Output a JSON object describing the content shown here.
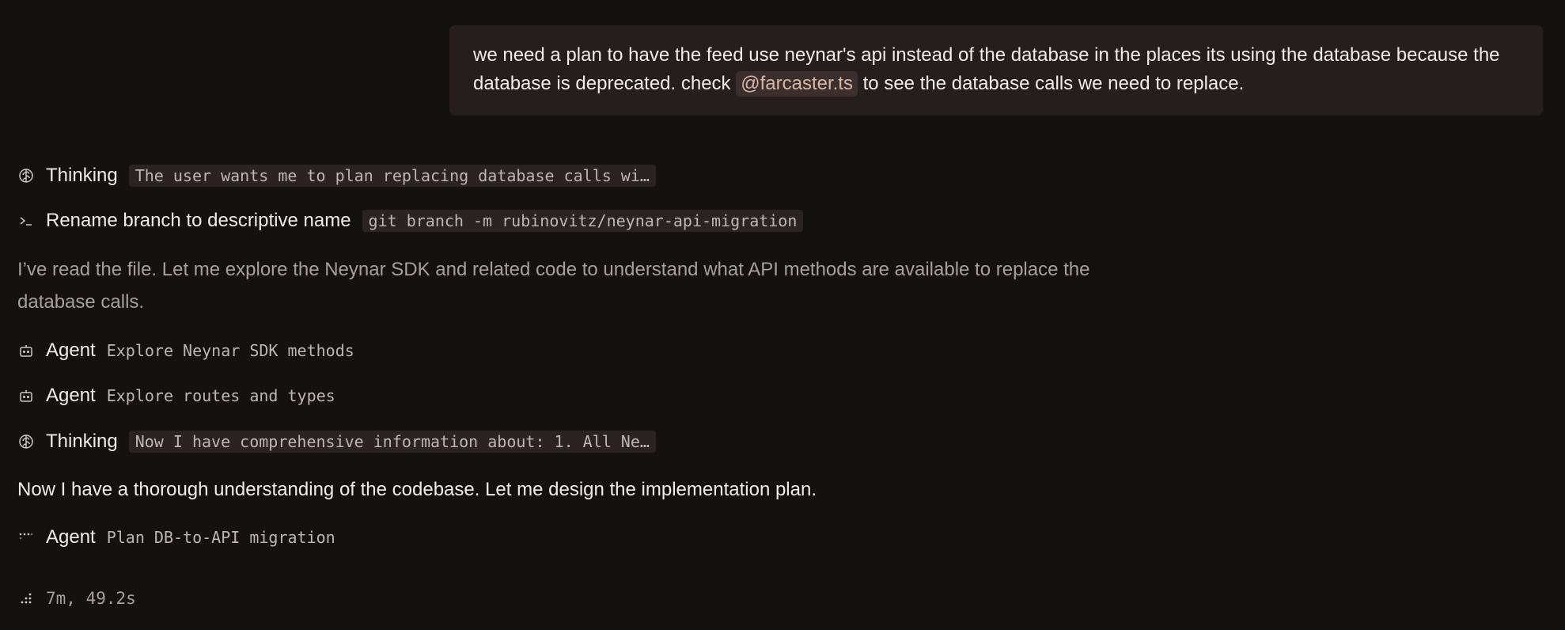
{
  "user_message": {
    "text_before": "we need a plan to have the feed use neynar's api instead of the database in the places its using the database because the database is deprecated. check",
    "mention": "@farcaster.ts",
    "text_after": "to see the database calls we need to replace."
  },
  "steps": [
    {
      "icon": "brain-icon",
      "label": "Thinking",
      "detail": "The user wants me to plan replacing database calls wi…"
    },
    {
      "icon": "terminal-icon",
      "label": "Rename branch to descriptive name",
      "detail": "git branch -m rubinovitz/neynar-api-migration"
    },
    {
      "icon": "robot-icon",
      "label": "Agent",
      "detail": "Explore Neynar SDK methods"
    },
    {
      "icon": "robot-icon",
      "label": "Agent",
      "detail": "Explore routes and types"
    },
    {
      "icon": "brain-icon",
      "label": "Thinking",
      "detail": "Now I have comprehensive information about: 1. All Ne…"
    },
    {
      "icon": "dots-spinner-icon",
      "label": "Agent",
      "detail": "Plan DB-to-API migration"
    }
  ],
  "messages": {
    "read_file": "I’ve read the file. Let me explore the Neynar SDK and related code to understand what API methods are available to replace the database calls.",
    "understanding": "Now I have a thorough understanding of the codebase. Let me design the implementation plan."
  },
  "status": {
    "icon": "loading-dots-icon",
    "elapsed": "7m, 49.2s"
  }
}
